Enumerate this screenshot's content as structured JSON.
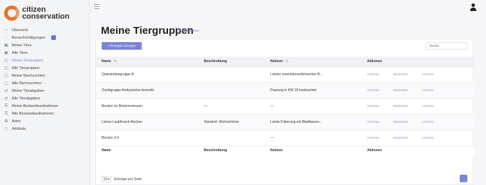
{
  "logo": {
    "line1": "citizen",
    "line2": "conservation"
  },
  "sidebar": {
    "items": [
      {
        "label": "Übersicht",
        "icon": "home-icon",
        "glyph": "⌂",
        "active": false,
        "badge": false
      },
      {
        "label": "Benachrichtigungen",
        "icon": "bell-icon",
        "glyph": "◌",
        "active": false,
        "badge": true
      },
      {
        "label": "Meine Tiere",
        "icon": "paw-icon",
        "glyph": "▣",
        "active": false,
        "badge": false
      },
      {
        "label": "Alle Tiere",
        "icon": "paw-icon",
        "glyph": "▣",
        "active": false,
        "badge": false
      },
      {
        "label": "Meine Tiergruppen",
        "icon": "group-icon",
        "glyph": "◫",
        "active": true,
        "badge": false
      },
      {
        "label": "Alle Tiergruppen",
        "icon": "group-icon",
        "glyph": "◫",
        "active": false,
        "badge": false
      },
      {
        "label": "Meine Nachzuchten",
        "icon": "egg-icon",
        "glyph": "▢",
        "active": false,
        "badge": false
      },
      {
        "label": "Alle Nachzuchten",
        "icon": "egg-icon",
        "glyph": "▢",
        "active": false,
        "badge": false
      },
      {
        "label": "Meine Tierabgaben",
        "icon": "transfer-icon",
        "glyph": "⇄",
        "active": false,
        "badge": false
      },
      {
        "label": "Alle Tierabgaben",
        "icon": "transfer-icon",
        "glyph": "⇄",
        "active": false,
        "badge": false
      },
      {
        "label": "Meine Bestandsaufnahmen",
        "icon": "list-icon",
        "glyph": "☰",
        "active": false,
        "badge": false
      },
      {
        "label": "Alle Bestandsaufnahmen",
        "icon": "list-icon",
        "glyph": "☰",
        "active": false,
        "badge": false
      },
      {
        "label": "Arten",
        "icon": "species-icon",
        "glyph": "✿",
        "active": false,
        "badge": false
      },
      {
        "label": "Attribute",
        "icon": "tag-icon",
        "glyph": "◇",
        "active": false,
        "badge": false
      }
    ]
  },
  "page": {
    "title": "Meine Tiergruppen",
    "back_link": "Zurücksetzen"
  },
  "toolbar": {
    "add_label": "+ Anlegen Gruppe",
    "search_placeholder": "Suche"
  },
  "table": {
    "columns": [
      "Name",
      "Beschreibung",
      "Notizen",
      "Aktionen"
    ],
    "rows": [
      {
        "name": "Quarantänegruppe A",
        "beschreibung": "",
        "notizen": "Letzter veterinärmedizinischer B...",
        "actions": [
          "Ansehen",
          "Bearbeiten",
          "Löschen"
        ]
      },
      {
        "name": "Zuchtgruppe Ambystoma dumerilii",
        "beschreibung": "",
        "notizen": "Paarung in KW 18 beobachtet",
        "actions": [
          "Ansehen",
          "Bearbeiten",
          "Löschen"
        ]
      },
      {
        "name": "Becken im Büroinnenraum",
        "beschreibung": "—",
        "notizen": "—",
        "actions": [
          "Ansehen",
          "Bearbeiten",
          "Löschen"
        ]
      },
      {
        "name": "Lemur-Laubfrosch-Becken",
        "beschreibung": "Standort: Wohnzimmer",
        "notizen": "Letzte Fütterung mit Blattläusen...",
        "actions": [
          "Ansehen",
          "Bearbeiten",
          "Löschen"
        ]
      },
      {
        "name": "Becken 2.0",
        "beschreibung": "",
        "notizen": "—",
        "actions": [
          "Ansehen",
          "Bearbeiten",
          "Löschen"
        ]
      }
    ]
  },
  "footer": {
    "per_page_value": "10",
    "per_page_label": "Einträge pro Seite"
  },
  "colors": {
    "accent": "#7b84d9",
    "logo_orange": "#e8712a"
  }
}
